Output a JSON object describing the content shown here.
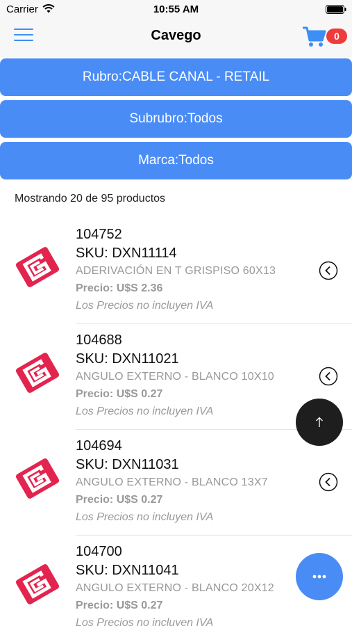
{
  "status": {
    "carrier": "Carrier",
    "time": "10:55 AM"
  },
  "nav": {
    "title": "Cavego",
    "cart_count": "0"
  },
  "filters": {
    "rubro": "Rubro:CABLE CANAL - RETAIL",
    "subrubro": "Subrubro:Todos",
    "marca": "Marca:Todos"
  },
  "results": {
    "count_text": "Mostrando 20 de 95 productos"
  },
  "products": [
    {
      "code": "104752",
      "sku": "SKU: DXN11114",
      "description": "ADERIVACIÓN EN T GRISPISO 60X13",
      "price": "Precio: U$S 2.36",
      "iva_note": "Los Precios no incluyen IVA"
    },
    {
      "code": "104688",
      "sku": "SKU: DXN11021",
      "description": "ANGULO EXTERNO - BLANCO 10X10",
      "price": "Precio: U$S 0.27",
      "iva_note": "Los Precios no incluyen IVA"
    },
    {
      "code": "104694",
      "sku": "SKU: DXN11031",
      "description": "ANGULO EXTERNO - BLANCO 13X7",
      "price": "Precio: U$S 0.27",
      "iva_note": "Los Precios no incluyen IVA"
    },
    {
      "code": "104700",
      "sku": "SKU: DXN11041",
      "description": "ANGULO EXTERNO - BLANCO 20X12",
      "price": "Precio: U$S 0.27",
      "iva_note": "Los Precios no incluyen IVA"
    }
  ],
  "colors": {
    "accent": "#4a8cf6",
    "badge": "#ef3b3b",
    "brand_logo": "#e3244f",
    "fab_dark": "#1e1e1e"
  },
  "icons": {
    "menu": "hamburger-icon",
    "cart": "cart-icon",
    "chevron": "chevron-left-circle-icon",
    "fab_top": "arrow-up-icon",
    "fab_more": "ellipsis-icon",
    "logo": "brand-logo-icon"
  }
}
